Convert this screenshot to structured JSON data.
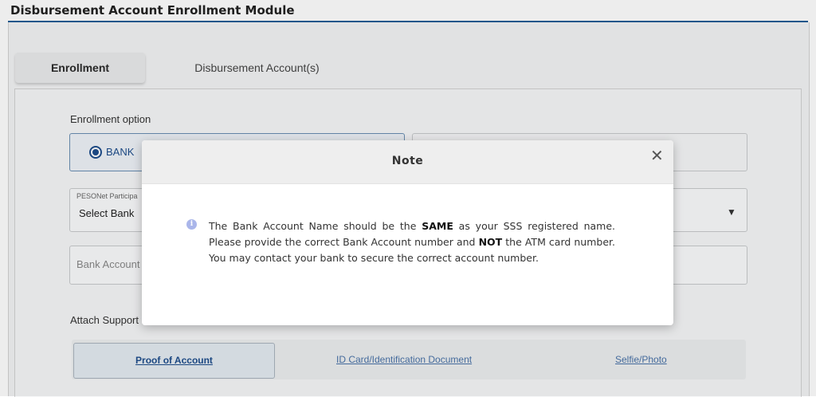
{
  "page": {
    "title": "Disbursement Account Enrollment Module"
  },
  "tabs": [
    {
      "label": "Enrollment",
      "active": true
    },
    {
      "label": "Disbursement Account(s)",
      "active": false
    }
  ],
  "form": {
    "enrollment_option_label": "Enrollment option",
    "options": [
      {
        "label": "BANK",
        "selected": true
      }
    ],
    "bank_select": {
      "caption": "PESONet Participa",
      "value": "Select Bank"
    },
    "account_field": {
      "placeholder": "Bank Account"
    },
    "attach_label": "Attach Support",
    "documents": [
      {
        "label": "Proof of Account",
        "active": true
      },
      {
        "label": "ID Card/Identification Document",
        "active": false
      },
      {
        "label": "Selfie/Photo",
        "active": false
      }
    ]
  },
  "modal": {
    "title": "Note",
    "close_glyph": "✕",
    "message": {
      "part1": "The Bank Account Name should be the ",
      "bold1": "SAME",
      "part2": " as your SSS registered name. Please provide the correct Bank Account number and ",
      "bold2": "NOT",
      "part3": " the ATM card number. You may contact your bank to secure the correct account number."
    }
  },
  "colors": {
    "accent": "#1f5d96",
    "link": "#4a73a8",
    "info_icon": "#aab6ea"
  },
  "icons": {
    "info": "info-icon",
    "close": "close-icon",
    "dropdown": "chevron-down-icon"
  }
}
